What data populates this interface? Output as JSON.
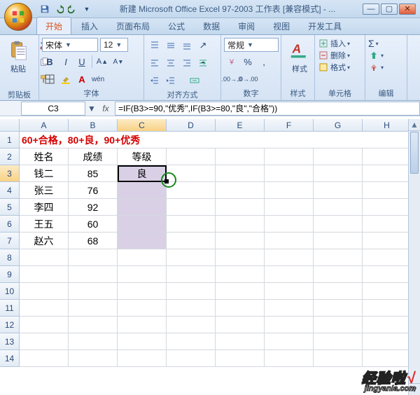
{
  "title": "新建 Microsoft Office Excel 97-2003 工作表  [兼容模式] - ...",
  "tabs": [
    "开始",
    "插入",
    "页面布局",
    "公式",
    "数据",
    "审阅",
    "视图",
    "开发工具"
  ],
  "active_tab": 0,
  "font": {
    "name": "宋体",
    "size": "12"
  },
  "number_format": "常规",
  "groups": {
    "clipboard": "剪贴板",
    "font": "字体",
    "align": "对齐方式",
    "number": "数字",
    "styles": "样式",
    "cells": "单元格",
    "edit": "编辑"
  },
  "paste_label": "粘贴",
  "styles_label": "样式",
  "cell_ops": {
    "insert": "插入",
    "delete": "删除",
    "format": "格式"
  },
  "namebox": "C3",
  "formula": "=IF(B3>=90,\"优秀\",IF(B3>=80,\"良\",\"合格\"))",
  "cols": [
    "A",
    "B",
    "C",
    "D",
    "E",
    "F",
    "G",
    "H"
  ],
  "grid": {
    "row_labels": [
      "1",
      "2",
      "3",
      "4",
      "5",
      "6",
      "7",
      "8",
      "9",
      "10",
      "11",
      "12",
      "13",
      "14"
    ],
    "red_text": "60+合格，80+良，90+优秀",
    "headers": {
      "a": "姓名",
      "b": "成绩",
      "c": "等级"
    },
    "data": [
      {
        "a": "钱二",
        "b": "85",
        "c": "良"
      },
      {
        "a": "张三",
        "b": "76",
        "c": ""
      },
      {
        "a": "李四",
        "b": "92",
        "c": ""
      },
      {
        "a": "王五",
        "b": "60",
        "c": ""
      },
      {
        "a": "赵六",
        "b": "68",
        "c": ""
      }
    ]
  },
  "watermark": {
    "line1": "经验啦",
    "check": "√",
    "line2": "jingyanla.com"
  },
  "colors": {
    "accent": "#3b5b82",
    "selected_hdr": "#f8d285",
    "purple": "#d9d0e6",
    "red": "#d60000"
  }
}
